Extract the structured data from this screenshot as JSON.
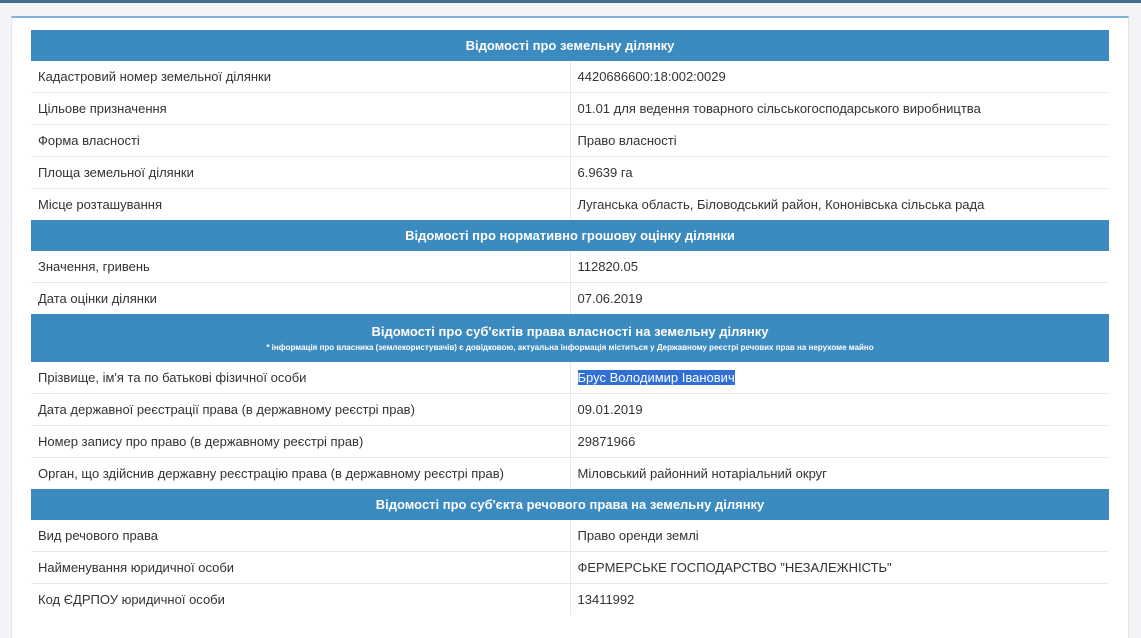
{
  "sections": [
    {
      "title": "Відомості про земельну ділянку",
      "rows": [
        {
          "label": "Кадастровий номер земельної ділянки",
          "value": "4420686600:18:002:0029"
        },
        {
          "label": "Цільове призначення",
          "value": "01.01 для ведення товарного сільськогосподарського виробництва"
        },
        {
          "label": "Форма власності",
          "value": "Право власності"
        },
        {
          "label": "Площа земельної ділянки",
          "value": "6.9639 га"
        },
        {
          "label": "Місце розташування",
          "value": "Луганська область, Біловодський район, Кононівська сільська рада"
        }
      ]
    },
    {
      "title": "Відомості про нормативно грошову оцінку ділянки",
      "rows": [
        {
          "label": "Значення, гривень",
          "value": "112820.05"
        },
        {
          "label": "Дата оцінки ділянки",
          "value": "07.06.2019"
        }
      ]
    },
    {
      "title": "Відомості про суб'єктів права власності на земельну ділянку",
      "note": "* інформація про власника (землекористувачів) є довідковою, актуальна інформація міститься у Державному реєстрі речових прав на нерухоме майно",
      "rows": [
        {
          "label": "Прізвище, ім'я та по батькові фізичної особи",
          "value": "Брус Володимир Іванович"
        },
        {
          "label": "Дата державної реєстрації права (в державному реєстрі прав)",
          "value": "09.01.2019"
        },
        {
          "label": "Номер запису про право (в державному реєстрі прав)",
          "value": "29871966"
        },
        {
          "label": "Орган, що здійснив державну реєстрацію права (в державному реєстрі прав)",
          "value": "Міловський районний нотаріальний округ"
        }
      ]
    },
    {
      "title": "Відомості про суб'єкта речового права на земельну ділянку",
      "rows": [
        {
          "label": "Вид речового права",
          "value": "Право оренди землі"
        },
        {
          "label": "Найменування юридичної особи",
          "value": "ФЕРМЕРСЬКЕ ГОСПОДАРСТВО \"НЕЗАЛЕЖНІСТЬ\""
        },
        {
          "label": "Код ЄДРПОУ юридичної особи",
          "value": "13411992"
        }
      ]
    }
  ],
  "colors": {
    "header_bg": "#3b8ac0",
    "header_text": "#ffffff",
    "selection": "#2f6fd6"
  }
}
